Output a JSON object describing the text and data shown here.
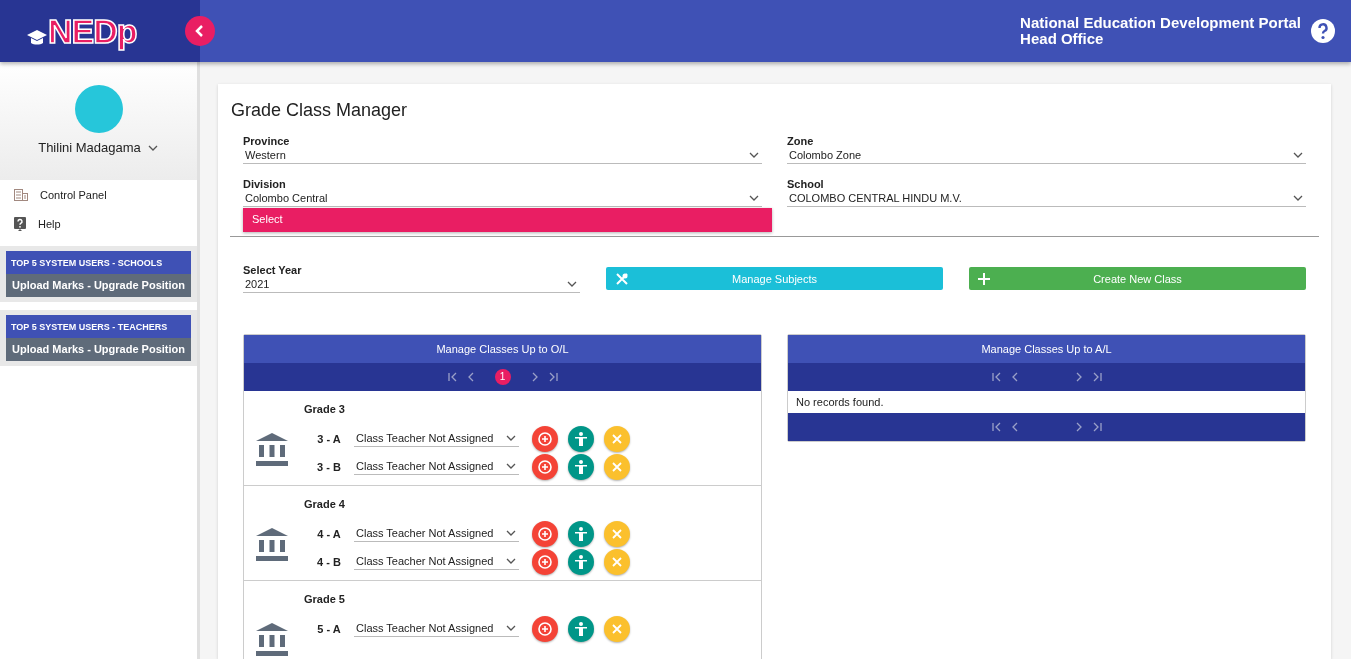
{
  "header": {
    "logo": "NEDp",
    "title_lines": [
      "National Education Development Portal",
      "Head Office"
    ]
  },
  "sidebar": {
    "user": "Thilini Madagama",
    "menu": [
      {
        "label": "Control Panel",
        "kind": "panel"
      },
      {
        "label": "Help",
        "kind": "help"
      }
    ],
    "promos": [
      {
        "title": "TOP 5 SYSTEM USERS - SCHOOLS",
        "action": "Upload Marks - Upgrade Position"
      },
      {
        "title": "TOP 5 SYSTEM USERS - TEACHERS",
        "action": "Upload Marks - Upgrade Position"
      }
    ]
  },
  "page": {
    "title": "Grade Class Manager",
    "filters": [
      {
        "label": "Province",
        "value": "Western"
      },
      {
        "label": "Zone",
        "value": "Colombo Zone"
      },
      {
        "label": "Division",
        "value": "Colombo Central",
        "options": [
          "Select"
        ]
      },
      {
        "label": "School",
        "value": "COLOMBO CENTRAL HINDU M.V."
      }
    ],
    "year": {
      "label": "Select Year",
      "value": "2021"
    },
    "buttons": [
      {
        "label": "Manage Subjects",
        "kind": "subjects"
      },
      {
        "label": "Create New Class",
        "kind": "create"
      }
    ],
    "panels": [
      {
        "title": "Manage Classes Up to O/L",
        "current_page": "1",
        "grades": [
          {
            "name": "Grade 3",
            "classes": [
              {
                "name": "3 - A",
                "teacher": "Class Teacher Not Assigned"
              },
              {
                "name": "3 - B",
                "teacher": "Class Teacher Not Assigned"
              }
            ]
          },
          {
            "name": "Grade 4",
            "classes": [
              {
                "name": "4 - A",
                "teacher": "Class Teacher Not Assigned"
              },
              {
                "name": "4 - B",
                "teacher": "Class Teacher Not Assigned"
              }
            ]
          },
          {
            "name": "Grade 5",
            "classes": [
              {
                "name": "5 - A",
                "teacher": "Class Teacher Not Assigned"
              }
            ]
          }
        ]
      },
      {
        "title": "Manage Classes Up to A/L",
        "empty_message": "No records found.",
        "bottom_pager": true
      }
    ]
  }
}
